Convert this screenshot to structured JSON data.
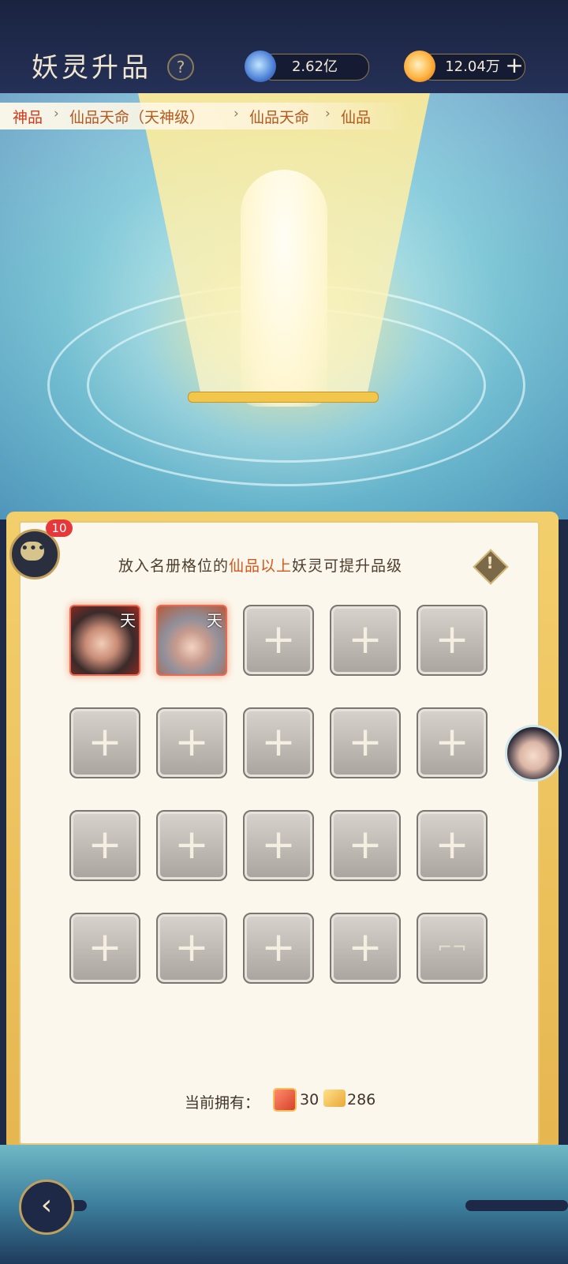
{
  "header": {
    "title": "妖灵升品",
    "help_icon": "question-mark",
    "currency_1": {
      "icon": "spirit-crystal-icon",
      "value": "2.62亿"
    },
    "currency_2": {
      "icon": "flame-orb-icon",
      "value": "12.04万"
    },
    "add_label": "+"
  },
  "breadcrumb": {
    "items": [
      "神品",
      "仙品天命（天神级）",
      "仙品天命",
      "仙品"
    ],
    "separator": "›"
  },
  "chat": {
    "badge": "10",
    "icon": "chat-bubble-icon"
  },
  "panel": {
    "instruction_prefix": "放入名册格位的",
    "instruction_highlight": "仙品以上",
    "instruction_suffix": "妖灵可提升品级",
    "warning_icon": "!",
    "slots": {
      "filled": [
        {
          "label": "天"
        },
        {
          "label": "天"
        }
      ],
      "empty_symbol": "+",
      "locked_symbol": "⌐¬"
    },
    "owned": {
      "label": "当前拥有：",
      "item1_value": "30",
      "item2_value": "286"
    }
  },
  "footer": {
    "back_icon": "back-arrow-icon",
    "back_symbol": "‹"
  },
  "colors": {
    "accent": "#d6561a",
    "badge": "#e6383b",
    "panel_border": "#e6c978"
  }
}
